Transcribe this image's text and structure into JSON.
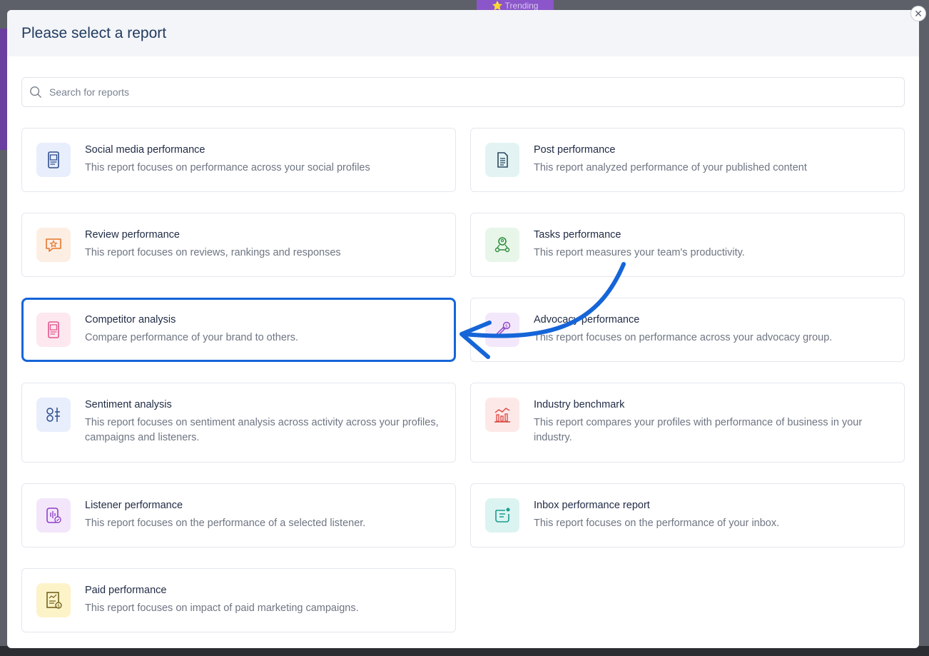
{
  "background": {
    "trending_label": "⭐ Trending"
  },
  "modal": {
    "title": "Please select a report",
    "close_glyph": "✕",
    "search_placeholder": "Search for reports"
  },
  "colors": {
    "accent": "#1565d8",
    "title": "#1f3a5f"
  },
  "reports": [
    {
      "title": "Social media performance",
      "description": "This report focuses on performance across your social profiles",
      "icon": "social-media-icon",
      "icon_bg": "#e8eefb",
      "icon_color": "#2f4f8f"
    },
    {
      "title": "Post performance",
      "description": "This report analyzed performance of your published content",
      "icon": "document-icon",
      "icon_bg": "#e3f3f4",
      "icon_color": "#2b4a5e"
    },
    {
      "title": "Review performance",
      "description": "This report focuses on reviews, rankings and responses",
      "icon": "star-chat-icon",
      "icon_bg": "#fdeee4",
      "icon_color": "#e4772d"
    },
    {
      "title": "Tasks performance",
      "description": "This report measures your team's productivity.",
      "icon": "team-icon",
      "icon_bg": "#e7f6e9",
      "icon_color": "#2e8b3a"
    },
    {
      "title": "Competitor analysis",
      "description": "Compare performance of your brand to others.",
      "icon": "competitor-icon",
      "icon_bg": "#fde8f0",
      "icon_color": "#e2578e",
      "highlighted": true
    },
    {
      "title": "Advocacy performance",
      "description": "This report focuses on performance across your advocacy group.",
      "icon": "advocacy-icon",
      "icon_bg": "#f3e8fb",
      "icon_color": "#8e44c7"
    },
    {
      "title": "Sentiment analysis",
      "description": "This report focuses on sentiment analysis across activity across your profiles, campaigns and listeners.",
      "icon": "sentiment-icon",
      "icon_bg": "#e8eefb",
      "icon_color": "#2f4f8f"
    },
    {
      "title": "Industry benchmark",
      "description": "This report compares your profiles with performance of business in your industry.",
      "icon": "benchmark-icon",
      "icon_bg": "#fde8e8",
      "icon_color": "#d9463f"
    },
    {
      "title": "Listener performance",
      "description": "This report focuses on the performance of a selected listener.",
      "icon": "listener-icon",
      "icon_bg": "#f3e6fa",
      "icon_color": "#8e3fc7"
    },
    {
      "title": "Inbox performance report",
      "description": "This report focuses on the performance of your inbox.",
      "icon": "inbox-icon",
      "icon_bg": "#dcf4f1",
      "icon_color": "#1a9b8e"
    },
    {
      "title": "Paid performance",
      "description": "This report focuses on impact of paid marketing campaigns.",
      "icon": "paid-icon",
      "icon_bg": "#fdf3c9",
      "icon_color": "#6b5a12"
    }
  ]
}
